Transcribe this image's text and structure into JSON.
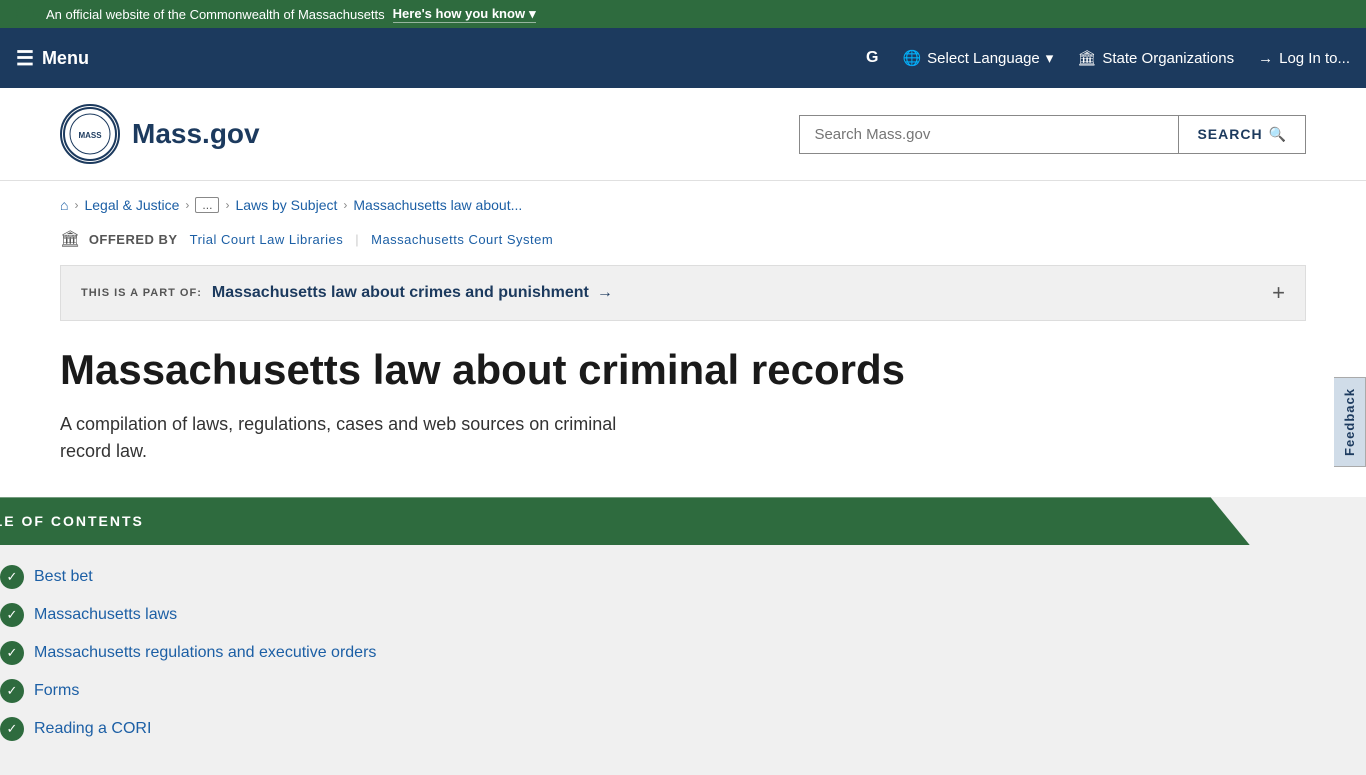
{
  "topBanner": {
    "official_text": "An official website of the Commonwealth of Massachusetts",
    "here_link_text": "Here's how you know",
    "chevron": "▾"
  },
  "navbar": {
    "menu_label": "Menu",
    "select_language": "Select Language",
    "state_organizations": "State Organizations",
    "log_in": "Log In to..."
  },
  "header": {
    "logo_text": "Mass.gov",
    "search_placeholder": "Search Mass.gov",
    "search_button": "SEARCH"
  },
  "breadcrumb": {
    "home_icon": "⌂",
    "legal_justice": "Legal & Justice",
    "ellipsis": "...",
    "laws_by_subject": "Laws by Subject",
    "current": "Massachusetts law about..."
  },
  "offeredBy": {
    "icon": "🏛",
    "label": "OFFERED BY",
    "org1": "Trial Court Law Libraries",
    "org2": "Massachusetts Court System"
  },
  "partOf": {
    "label": "THIS IS A PART OF:",
    "link_text": "Massachusetts law about crimes and punishment",
    "arrow": "→",
    "plus": "+"
  },
  "pageTitle": "Massachusetts law about criminal records",
  "pageDesc": "A compilation of laws, regulations, cases and web sources on criminal record law.",
  "toc": {
    "header": "TABLE OF CONTENTS",
    "items": [
      {
        "label": "Best bet"
      },
      {
        "label": "Massachusetts laws"
      },
      {
        "label": "Massachusetts regulations and executive orders"
      },
      {
        "label": "Forms"
      },
      {
        "label": "Reading a CORI"
      }
    ]
  },
  "feedback": {
    "label": "Feedback"
  }
}
